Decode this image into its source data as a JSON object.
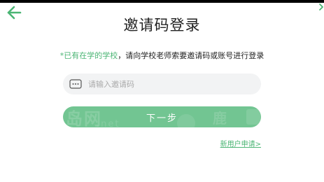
{
  "header": {
    "back_icon": "arrow-left-icon",
    "title": "邀请码登录"
  },
  "hint": {
    "highlight": "*已有在学的学校",
    "rest": "，请向学校老师索要邀请码或账号进行登录"
  },
  "code_input": {
    "icon": "keypad-icon",
    "placeholder": "请输入邀请码",
    "value": ""
  },
  "next_button": {
    "label": "下一步"
  },
  "register_link": {
    "label": "新用户申请>"
  },
  "colors": {
    "accent": "#4bb574",
    "button": "#72c592",
    "input_bg": "#f2f3f4",
    "title": "#222222"
  }
}
